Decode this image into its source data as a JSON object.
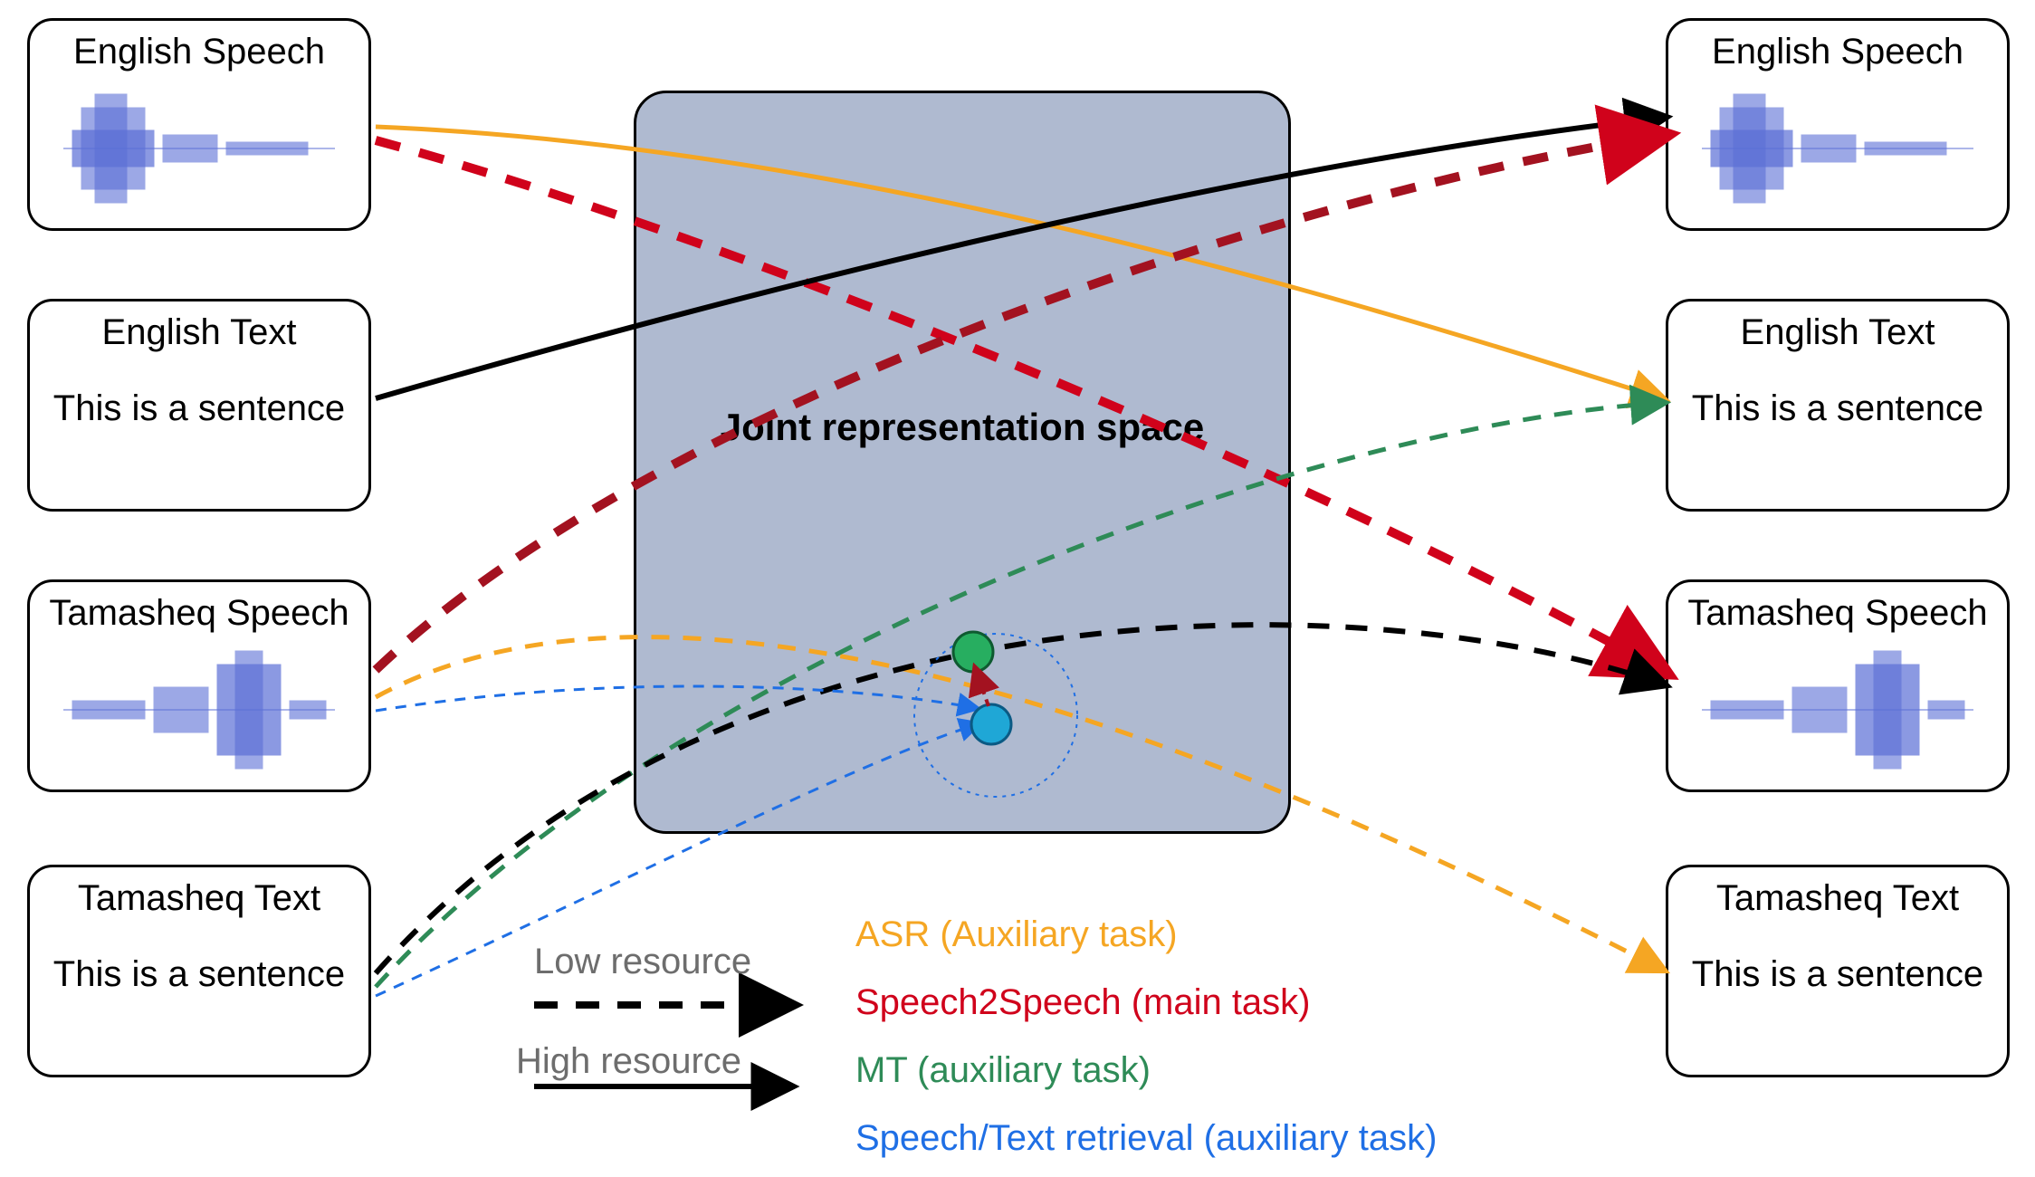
{
  "left_boxes": {
    "english_speech": {
      "label": "English Speech"
    },
    "english_text": {
      "label": "English Text",
      "example": "This is a sentence"
    },
    "tamasheq_speech": {
      "label": "Tamasheq Speech"
    },
    "tamasheq_text": {
      "label": "Tamasheq Text",
      "example": "This is a sentence"
    }
  },
  "right_boxes": {
    "english_speech": {
      "label": "English Speech"
    },
    "english_text": {
      "label": "English Text",
      "example": "This is a sentence"
    },
    "tamasheq_speech": {
      "label": "Tamasheq Speech"
    },
    "tamasheq_text": {
      "label": "Tamasheq Text",
      "example": "This is a sentence"
    }
  },
  "center": {
    "label": "Joint representation space"
  },
  "legend": {
    "low_resource": "Low resource",
    "high_resource": "High resource",
    "asr": "ASR (Auxiliary task)",
    "speech2speech": "Speech2Speech (main task)",
    "mt": "MT (auxiliary task)",
    "retrieval": "Speech/Text retrieval (auxiliary task)"
  },
  "colors": {
    "asr": "#f5a623",
    "s2s": "#d0021b",
    "mt": "#2e8b57",
    "retrieval": "#1f6fe5",
    "black": "#000000",
    "grey": "#6d6d6d",
    "dot_green": "#27ae60",
    "dot_blue": "#1fa7d6"
  }
}
